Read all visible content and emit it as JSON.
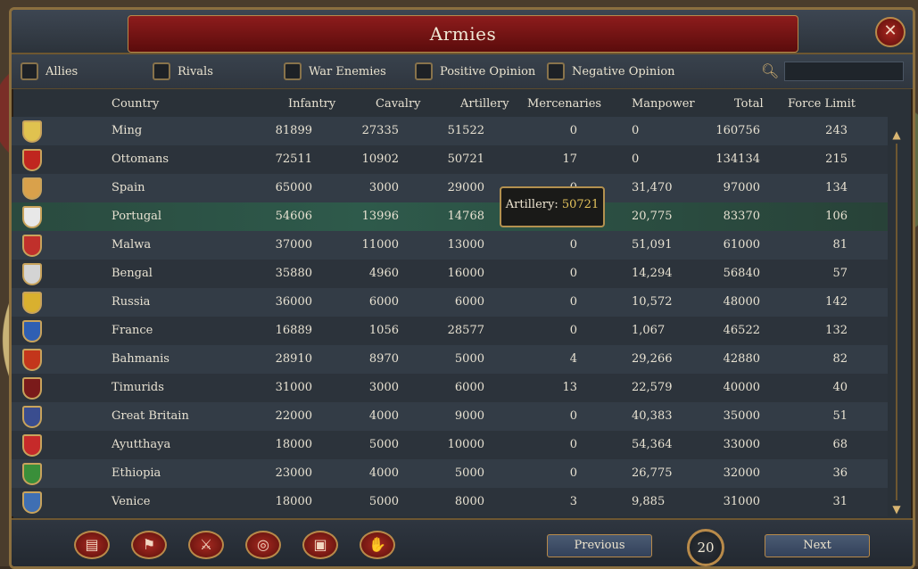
{
  "window": {
    "title": "Armies",
    "close_icon": "close-icon"
  },
  "filters": [
    {
      "label": "Allies"
    },
    {
      "label": "Rivals"
    },
    {
      "label": "War Enemies"
    },
    {
      "label": "Positive Opinion"
    },
    {
      "label": "Negative Opinion"
    }
  ],
  "search": {
    "value": "",
    "placeholder": ""
  },
  "columns": [
    "Country",
    "Infantry",
    "Cavalry",
    "Artillery",
    "Mercenaries",
    "Manpower",
    "Total",
    "Force Limit"
  ],
  "rows": [
    {
      "country": "Ming",
      "infantry": "81899",
      "cavalry": "27335",
      "artillery": "51522",
      "mercenaries": "0",
      "manpower": "0",
      "total": "160756",
      "force_limit": "243",
      "flag_color": "#e0c24f"
    },
    {
      "country": "Ottomans",
      "infantry": "72511",
      "cavalry": "10902",
      "artillery": "50721",
      "mercenaries": "17",
      "manpower": "0",
      "total": "134134",
      "force_limit": "215",
      "flag_color": "#c0261f"
    },
    {
      "country": "Spain",
      "infantry": "65000",
      "cavalry": "3000",
      "artillery": "29000",
      "mercenaries": "0",
      "manpower": "31,470",
      "total": "97000",
      "force_limit": "134",
      "flag_color": "#d9a14b"
    },
    {
      "country": "Portugal",
      "infantry": "54606",
      "cavalry": "13996",
      "artillery": "14768",
      "mercenaries": "",
      "manpower": "20,775",
      "total": "83370",
      "force_limit": "106",
      "flag_color": "#e8e8e8"
    },
    {
      "country": "Malwa",
      "infantry": "37000",
      "cavalry": "11000",
      "artillery": "13000",
      "mercenaries": "0",
      "manpower": "51,091",
      "total": "61000",
      "force_limit": "81",
      "flag_color": "#c0302b"
    },
    {
      "country": "Bengal",
      "infantry": "35880",
      "cavalry": "4960",
      "artillery": "16000",
      "mercenaries": "0",
      "manpower": "14,294",
      "total": "56840",
      "force_limit": "57",
      "flag_color": "#d4d4d4"
    },
    {
      "country": "Russia",
      "infantry": "36000",
      "cavalry": "6000",
      "artillery": "6000",
      "mercenaries": "0",
      "manpower": "10,572",
      "total": "48000",
      "force_limit": "142",
      "flag_color": "#d9b02f"
    },
    {
      "country": "France",
      "infantry": "16889",
      "cavalry": "1056",
      "artillery": "28577",
      "mercenaries": "0",
      "manpower": "1,067",
      "total": "46522",
      "force_limit": "132",
      "flag_color": "#2f5fb3"
    },
    {
      "country": "Bahmanis",
      "infantry": "28910",
      "cavalry": "8970",
      "artillery": "5000",
      "mercenaries": "4",
      "manpower": "29,266",
      "total": "42880",
      "force_limit": "82",
      "flag_color": "#c3361b"
    },
    {
      "country": "Timurids",
      "infantry": "31000",
      "cavalry": "3000",
      "artillery": "6000",
      "mercenaries": "13",
      "manpower": "22,579",
      "total": "40000",
      "force_limit": "40",
      "flag_color": "#7a1a1a"
    },
    {
      "country": "Great Britain",
      "infantry": "22000",
      "cavalry": "4000",
      "artillery": "9000",
      "mercenaries": "0",
      "manpower": "40,383",
      "total": "35000",
      "force_limit": "51",
      "flag_color": "#3a4d8f"
    },
    {
      "country": "Ayutthaya",
      "infantry": "18000",
      "cavalry": "5000",
      "artillery": "10000",
      "mercenaries": "0",
      "manpower": "54,364",
      "total": "33000",
      "force_limit": "68",
      "flag_color": "#c62a2a"
    },
    {
      "country": "Ethiopia",
      "infantry": "23000",
      "cavalry": "4000",
      "artillery": "5000",
      "mercenaries": "0",
      "manpower": "26,775",
      "total": "32000",
      "force_limit": "36",
      "flag_color": "#3a8f3a"
    },
    {
      "country": "Venice",
      "infantry": "18000",
      "cavalry": "5000",
      "artillery": "8000",
      "mercenaries": "3",
      "manpower": "9,885",
      "total": "31000",
      "force_limit": "31",
      "flag_color": "#3f6fb3"
    }
  ],
  "tooltip": {
    "label": "Artillery:",
    "value": "50721"
  },
  "footer": {
    "buttons": [
      {
        "icon": "ledger-icon"
      },
      {
        "icon": "flag-icon"
      },
      {
        "icon": "crossed-swords-icon"
      },
      {
        "icon": "coins-icon"
      },
      {
        "icon": "crate-icon"
      },
      {
        "icon": "handshake-icon"
      }
    ],
    "previous_label": "Previous",
    "next_label": "Next",
    "page": "20"
  },
  "colors": {
    "accent_gold": "#b88a4a",
    "title_red": "#8d1c1c",
    "highlight_row": "#2e5a4b"
  }
}
